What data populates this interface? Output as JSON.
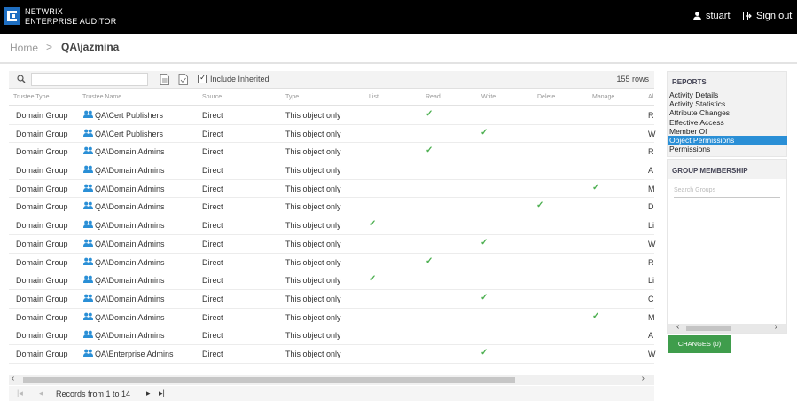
{
  "header": {
    "brand_line1": "NETWRIX",
    "brand_line2": "ENTERPRISE AUDITOR",
    "user_name": "stuart",
    "sign_out_label": "Sign out",
    "brand_color": "#000000"
  },
  "breadcrumb": {
    "home": "Home",
    "separator": ">",
    "current": "QA\\jazmina"
  },
  "toolbar": {
    "search_value": "",
    "include_inherited_label": "Include Inherited",
    "include_inherited_checked": true,
    "check_mark": "✓",
    "rows_count": "155 rows"
  },
  "table": {
    "columns": [
      "Trustee Type",
      "Trustee Name",
      "Source",
      "Type",
      "List",
      "Read",
      "Write",
      "Delete",
      "Manage",
      "Al"
    ],
    "rows": [
      {
        "trustee_type": "Domain Group",
        "trustee_name": "QA\\Cert Publishers",
        "source": "Direct",
        "type": "This object only",
        "list": false,
        "read": true,
        "write": false,
        "delete": false,
        "manage": false,
        "al": "R"
      },
      {
        "trustee_type": "Domain Group",
        "trustee_name": "QA\\Cert Publishers",
        "source": "Direct",
        "type": "This object only",
        "list": false,
        "read": false,
        "write": true,
        "delete": false,
        "manage": false,
        "al": "W"
      },
      {
        "trustee_type": "Domain Group",
        "trustee_name": "QA\\Domain Admins",
        "source": "Direct",
        "type": "This object only",
        "list": false,
        "read": true,
        "write": false,
        "delete": false,
        "manage": false,
        "al": "R"
      },
      {
        "trustee_type": "Domain Group",
        "trustee_name": "QA\\Domain Admins",
        "source": "Direct",
        "type": "This object only",
        "list": false,
        "read": false,
        "write": false,
        "delete": false,
        "manage": false,
        "al": "A"
      },
      {
        "trustee_type": "Domain Group",
        "trustee_name": "QA\\Domain Admins",
        "source": "Direct",
        "type": "This object only",
        "list": false,
        "read": false,
        "write": false,
        "delete": false,
        "manage": true,
        "al": "M"
      },
      {
        "trustee_type": "Domain Group",
        "trustee_name": "QA\\Domain Admins",
        "source": "Direct",
        "type": "This object only",
        "list": false,
        "read": false,
        "write": false,
        "delete": true,
        "manage": false,
        "al": "D"
      },
      {
        "trustee_type": "Domain Group",
        "trustee_name": "QA\\Domain Admins",
        "source": "Direct",
        "type": "This object only",
        "list": true,
        "read": false,
        "write": false,
        "delete": false,
        "manage": false,
        "al": "Li"
      },
      {
        "trustee_type": "Domain Group",
        "trustee_name": "QA\\Domain Admins",
        "source": "Direct",
        "type": "This object only",
        "list": false,
        "read": false,
        "write": true,
        "delete": false,
        "manage": false,
        "al": "W"
      },
      {
        "trustee_type": "Domain Group",
        "trustee_name": "QA\\Domain Admins",
        "source": "Direct",
        "type": "This object only",
        "list": false,
        "read": true,
        "write": false,
        "delete": false,
        "manage": false,
        "al": "R"
      },
      {
        "trustee_type": "Domain Group",
        "trustee_name": "QA\\Domain Admins",
        "source": "Direct",
        "type": "This object only",
        "list": true,
        "read": false,
        "write": false,
        "delete": false,
        "manage": false,
        "al": "Li"
      },
      {
        "trustee_type": "Domain Group",
        "trustee_name": "QA\\Domain Admins",
        "source": "Direct",
        "type": "This object only",
        "list": false,
        "read": false,
        "write": true,
        "delete": false,
        "manage": false,
        "al": "C"
      },
      {
        "trustee_type": "Domain Group",
        "trustee_name": "QA\\Domain Admins",
        "source": "Direct",
        "type": "This object only",
        "list": false,
        "read": false,
        "write": false,
        "delete": false,
        "manage": true,
        "al": "M"
      },
      {
        "trustee_type": "Domain Group",
        "trustee_name": "QA\\Domain Admins",
        "source": "Direct",
        "type": "This object only",
        "list": false,
        "read": false,
        "write": false,
        "delete": false,
        "manage": false,
        "al": "A"
      },
      {
        "trustee_type": "Domain Group",
        "trustee_name": "QA\\Enterprise Admins",
        "source": "Direct",
        "type": "This object only",
        "list": false,
        "read": false,
        "write": true,
        "delete": false,
        "manage": false,
        "al": "W"
      }
    ],
    "check_color": "#4caf50",
    "group_icon_color": "#2a8fd6"
  },
  "pager": {
    "first": "|◂",
    "prev": "◂",
    "records_text": "Records from 1 to 14",
    "next": "▸",
    "last": "▸|"
  },
  "reports": {
    "title": "REPORTS",
    "items": [
      "Activity Details",
      "Activity Statistics",
      "Attribute Changes",
      "Effective Access",
      "Member Of",
      "Object Permissions",
      "Permissions"
    ],
    "selected": "Object Permissions",
    "selected_color": "#2a8fd6"
  },
  "group_membership": {
    "title": "GROUP MEMBERSHIP",
    "search_placeholder": "Search Groups"
  },
  "changes_button": {
    "label": "CHANGES (0)",
    "color": "#3f9d4c"
  }
}
